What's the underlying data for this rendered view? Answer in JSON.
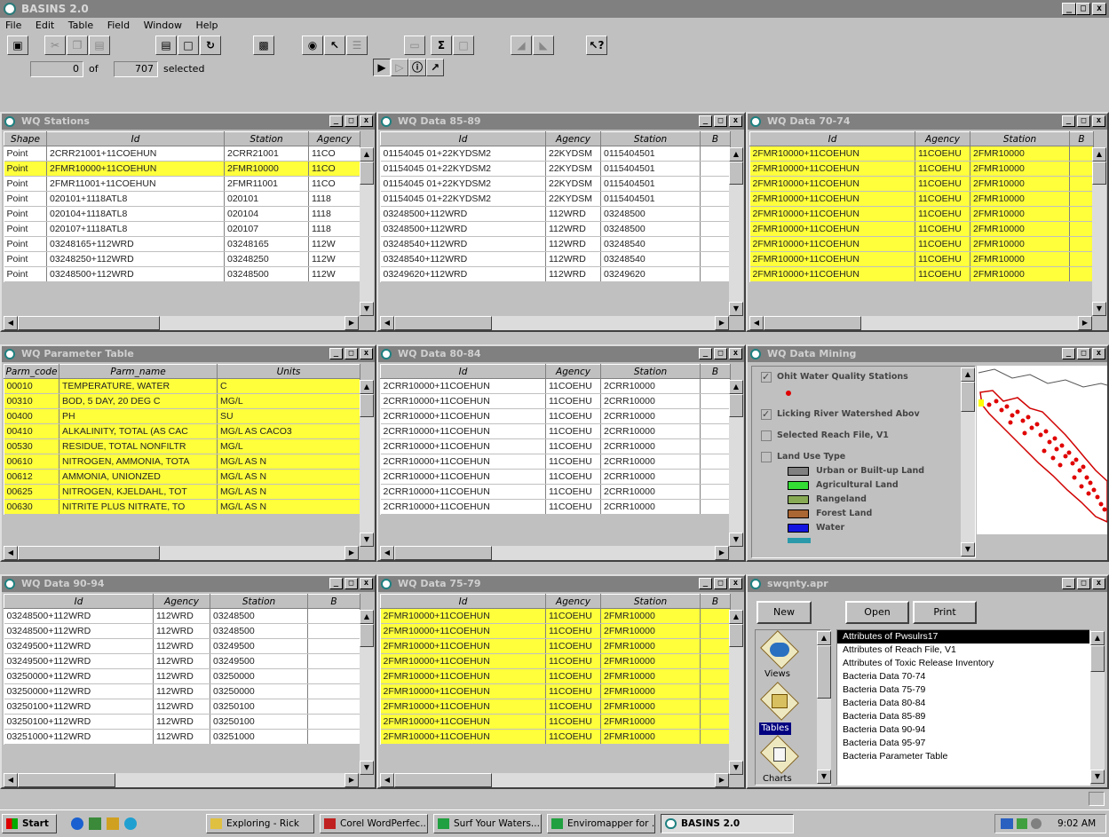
{
  "app": {
    "title": "BASINS 2.0"
  },
  "menu": [
    "File",
    "Edit",
    "Table",
    "Field",
    "Window",
    "Help"
  ],
  "status": {
    "count": "0",
    "of_label": "of",
    "total": "707",
    "selected_label": "selected"
  },
  "windows": {
    "wq_stations": {
      "title": "WQ Stations",
      "columns": [
        "Shape",
        "Id",
        "Station",
        "Agency"
      ],
      "rows": [
        [
          "Point",
          "2CRR21001+11COEHUN",
          "2CRR21001",
          "11CO"
        ],
        [
          "Point",
          "2FMR10000+11COEHUN",
          "2FMR10000",
          "11CO"
        ],
        [
          "Point",
          "2FMR11001+11COEHUN",
          "2FMR11001",
          "11CO"
        ],
        [
          "Point",
          "020101+1118ATL8",
          "020101",
          "1118"
        ],
        [
          "Point",
          "020104+1118ATL8",
          "020104",
          "1118"
        ],
        [
          "Point",
          "020107+1118ATL8",
          "020107",
          "1118"
        ],
        [
          "Point",
          "03248165+112WRD",
          "03248165",
          "112W"
        ],
        [
          "Point",
          "03248250+112WRD",
          "03248250",
          "112W"
        ],
        [
          "Point",
          "03248500+112WRD",
          "03248500",
          "112W"
        ]
      ]
    },
    "wq_data_85_89": {
      "title": "WQ Data 85-89",
      "columns": [
        "Id",
        "Agency",
        "Station",
        "B"
      ],
      "rows": [
        [
          "01154045 01+22KYDSM2",
          "22KYDSM",
          "0115404501",
          ""
        ],
        [
          "01154045 01+22KYDSM2",
          "22KYDSM",
          "0115404501",
          ""
        ],
        [
          "01154045 01+22KYDSM2",
          "22KYDSM",
          "0115404501",
          ""
        ],
        [
          "01154045 01+22KYDSM2",
          "22KYDSM",
          "0115404501",
          ""
        ],
        [
          "03248500+112WRD",
          "112WRD",
          "03248500",
          ""
        ],
        [
          "03248500+112WRD",
          "112WRD",
          "03248500",
          ""
        ],
        [
          "03248540+112WRD",
          "112WRD",
          "03248540",
          ""
        ],
        [
          "03248540+112WRD",
          "112WRD",
          "03248540",
          ""
        ],
        [
          "03249620+112WRD",
          "112WRD",
          "03249620",
          ""
        ]
      ]
    },
    "wq_data_70_74": {
      "title": "WQ Data 70-74",
      "columns": [
        "Id",
        "Agency",
        "Station",
        "B"
      ],
      "rows": [
        [
          "2FMR10000+11COEHUN",
          "11COEHU",
          "2FMR10000",
          ""
        ],
        [
          "2FMR10000+11COEHUN",
          "11COEHU",
          "2FMR10000",
          ""
        ],
        [
          "2FMR10000+11COEHUN",
          "11COEHU",
          "2FMR10000",
          ""
        ],
        [
          "2FMR10000+11COEHUN",
          "11COEHU",
          "2FMR10000",
          ""
        ],
        [
          "2FMR10000+11COEHUN",
          "11COEHU",
          "2FMR10000",
          ""
        ],
        [
          "2FMR10000+11COEHUN",
          "11COEHU",
          "2FMR10000",
          ""
        ],
        [
          "2FMR10000+11COEHUN",
          "11COEHU",
          "2FMR10000",
          ""
        ],
        [
          "2FMR10000+11COEHUN",
          "11COEHU",
          "2FMR10000",
          ""
        ],
        [
          "2FMR10000+11COEHUN",
          "11COEHU",
          "2FMR10000",
          ""
        ]
      ]
    },
    "wq_parameter_table": {
      "title": "WQ Parameter Table",
      "columns": [
        "Parm_code",
        "Parm_name",
        "Units"
      ],
      "rows": [
        [
          "00010",
          "TEMPERATURE, WATER",
          "C"
        ],
        [
          "00310",
          "BOD, 5 DAY, 20 DEG C",
          "MG/L"
        ],
        [
          "00400",
          "PH",
          "SU"
        ],
        [
          "00410",
          "ALKALINITY, TOTAL (AS CAC",
          "MG/L AS CACO3"
        ],
        [
          "00530",
          "RESIDUE, TOTAL NONFILTR",
          "MG/L"
        ],
        [
          "00610",
          "NITROGEN, AMMONIA, TOTA",
          "MG/L AS N"
        ],
        [
          "00612",
          "AMMONIA, UNIONZED",
          "MG/L AS N"
        ],
        [
          "00625",
          "NITROGEN, KJELDAHL, TOT",
          "MG/L AS N"
        ],
        [
          "00630",
          "NITRITE PLUS NITRATE, TO",
          "MG/L AS N"
        ]
      ]
    },
    "wq_data_80_84": {
      "title": "WQ Data 80-84",
      "columns": [
        "Id",
        "Agency",
        "Station",
        "B"
      ],
      "rows": [
        [
          "2CRR10000+11COEHUN",
          "11COEHU",
          "2CRR10000",
          ""
        ],
        [
          "2CRR10000+11COEHUN",
          "11COEHU",
          "2CRR10000",
          ""
        ],
        [
          "2CRR10000+11COEHUN",
          "11COEHU",
          "2CRR10000",
          ""
        ],
        [
          "2CRR10000+11COEHUN",
          "11COEHU",
          "2CRR10000",
          ""
        ],
        [
          "2CRR10000+11COEHUN",
          "11COEHU",
          "2CRR10000",
          ""
        ],
        [
          "2CRR10000+11COEHUN",
          "11COEHU",
          "2CRR10000",
          ""
        ],
        [
          "2CRR10000+11COEHUN",
          "11COEHU",
          "2CRR10000",
          ""
        ],
        [
          "2CRR10000+11COEHUN",
          "11COEHU",
          "2CRR10000",
          ""
        ],
        [
          "2CRR10000+11COEHUN",
          "11COEHU",
          "2CRR10000",
          ""
        ]
      ]
    },
    "wq_data_mining": {
      "title": "WQ Data Mining",
      "legend": [
        {
          "label": "Ohit Water Quality Stations",
          "checked": true
        },
        {
          "label": "Licking River Watershed Abov",
          "checked": true
        },
        {
          "label": "Selected Reach File, V1",
          "checked": false
        },
        {
          "label": "Land Use Type",
          "checked": false
        }
      ],
      "land_use": [
        {
          "label": "Urban or Built-up Land",
          "color": "#808080"
        },
        {
          "label": "Agricultural Land",
          "color": "#33dd33"
        },
        {
          "label": "Rangeland",
          "color": "#88aa55"
        },
        {
          "label": "Forest Land",
          "color": "#aa6633"
        },
        {
          "label": "Water",
          "color": "#1414e0"
        }
      ]
    },
    "wq_data_90_94": {
      "title": "WQ Data 90-94",
      "columns": [
        "Id",
        "Agency",
        "Station",
        "B"
      ],
      "rows": [
        [
          "03248500+112WRD",
          "112WRD",
          "03248500",
          ""
        ],
        [
          "03248500+112WRD",
          "112WRD",
          "03248500",
          ""
        ],
        [
          "03249500+112WRD",
          "112WRD",
          "03249500",
          ""
        ],
        [
          "03249500+112WRD",
          "112WRD",
          "03249500",
          ""
        ],
        [
          "03250000+112WRD",
          "112WRD",
          "03250000",
          ""
        ],
        [
          "03250000+112WRD",
          "112WRD",
          "03250000",
          ""
        ],
        [
          "03250100+112WRD",
          "112WRD",
          "03250100",
          ""
        ],
        [
          "03250100+112WRD",
          "112WRD",
          "03250100",
          ""
        ],
        [
          "03251000+112WRD",
          "112WRD",
          "03251000",
          ""
        ]
      ]
    },
    "wq_data_75_79": {
      "title": "WQ Data 75-79",
      "columns": [
        "Id",
        "Agency",
        "Station",
        "B"
      ],
      "rows": [
        [
          "2FMR10000+11COEHUN",
          "11COEHU",
          "2FMR10000",
          ""
        ],
        [
          "2FMR10000+11COEHUN",
          "11COEHU",
          "2FMR10000",
          ""
        ],
        [
          "2FMR10000+11COEHUN",
          "11COEHU",
          "2FMR10000",
          ""
        ],
        [
          "2FMR10000+11COEHUN",
          "11COEHU",
          "2FMR10000",
          ""
        ],
        [
          "2FMR10000+11COEHUN",
          "11COEHU",
          "2FMR10000",
          ""
        ],
        [
          "2FMR10000+11COEHUN",
          "11COEHU",
          "2FMR10000",
          ""
        ],
        [
          "2FMR10000+11COEHUN",
          "11COEHU",
          "2FMR10000",
          ""
        ],
        [
          "2FMR10000+11COEHUN",
          "11COEHU",
          "2FMR10000",
          ""
        ],
        [
          "2FMR10000+11COEHUN",
          "11COEHU",
          "2FMR10000",
          ""
        ]
      ]
    },
    "project": {
      "title": "swqnty.apr",
      "buttons": [
        "New",
        "Open",
        "Print"
      ],
      "icons": [
        "Views",
        "Tables",
        "Charts"
      ],
      "documents": [
        "Attributes of Pwsulrs17",
        "Attributes of Reach File, V1",
        "Attributes of Toxic Release Inventory",
        "Bacteria Data 70-74",
        "Bacteria Data 75-79",
        "Bacteria Data 80-84",
        "Bacteria Data 85-89",
        "Bacteria Data 90-94",
        "Bacteria Data 95-97",
        "Bacteria Parameter Table"
      ]
    }
  },
  "taskbar": {
    "start": "Start",
    "tasks": [
      "Exploring - Rick",
      "Corel WordPerfec...",
      "Surf Your Waters...",
      "Enviromapper for ...",
      "BASINS 2.0"
    ],
    "clock": "9:02 AM"
  },
  "colors": {
    "highlight": "#ffff3c",
    "titlebar": "#808080",
    "face": "#c0c0c0",
    "stations": "#e00000"
  }
}
